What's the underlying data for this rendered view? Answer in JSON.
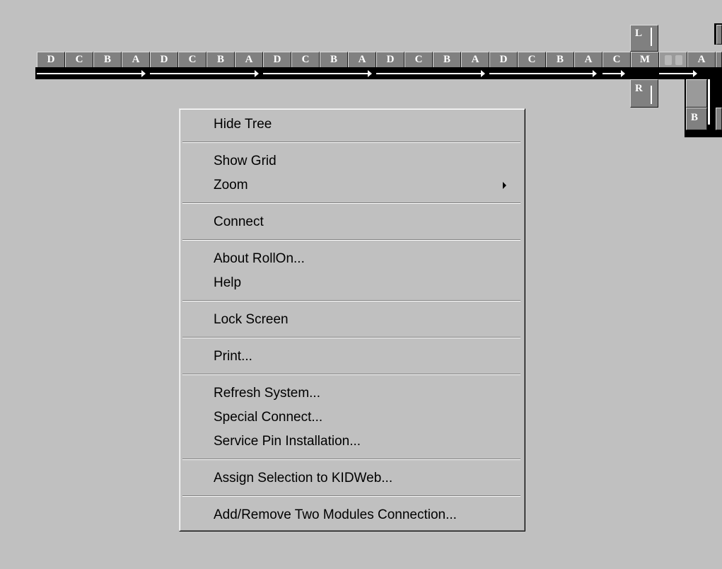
{
  "module_row": {
    "labels": [
      "D",
      "C",
      "B",
      "A",
      "D",
      "C",
      "B",
      "A",
      "D",
      "C",
      "B",
      "A",
      "D",
      "C",
      "B",
      "A",
      "D",
      "C",
      "B",
      "A",
      "C",
      "M",
      "",
      "",
      "A"
    ]
  },
  "branch": {
    "left_label": "L",
    "right_label": "R",
    "bottom_label": "B"
  },
  "context_menu": {
    "items": [
      {
        "label": "Hide Tree"
      },
      {
        "label": "Show Grid"
      },
      {
        "label": "Zoom",
        "submenu": true
      },
      {
        "label": "Connect"
      },
      {
        "label": "About RollOn..."
      },
      {
        "label": "Help"
      },
      {
        "label": "Lock Screen"
      },
      {
        "label": "Print..."
      },
      {
        "label": "Refresh System..."
      },
      {
        "label": "Special Connect..."
      },
      {
        "label": "Service Pin Installation..."
      },
      {
        "label": "Assign Selection to KIDWeb..."
      },
      {
        "label": "Add/Remove Two Modules Connection..."
      }
    ],
    "submenu_icon": "chevron-right-icon"
  },
  "colors": {
    "background": "#c0c0c0",
    "module_fill": "#808080",
    "rail": "#000000",
    "menu_face": "#c0c0c0"
  }
}
